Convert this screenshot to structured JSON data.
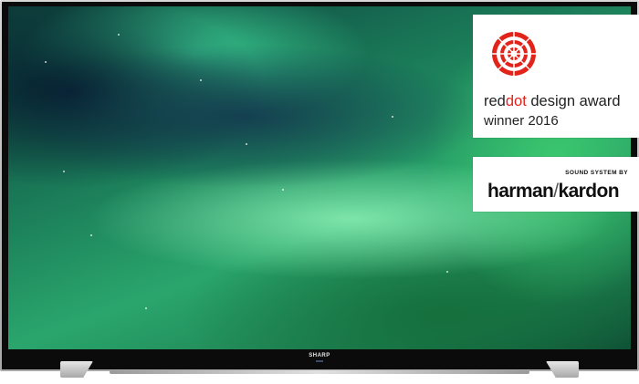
{
  "tv": {
    "brand": "SHARP"
  },
  "badges": {
    "reddot": {
      "line1_a": "red",
      "line1_b": "dot",
      "line1_c": " design award",
      "line2": "winner 2016",
      "accent_color": "#e2231a"
    },
    "harman": {
      "kicker": "SOUND SYSTEM BY",
      "logo_left": "harman",
      "logo_sep": "/",
      "logo_right": "kardon"
    }
  }
}
